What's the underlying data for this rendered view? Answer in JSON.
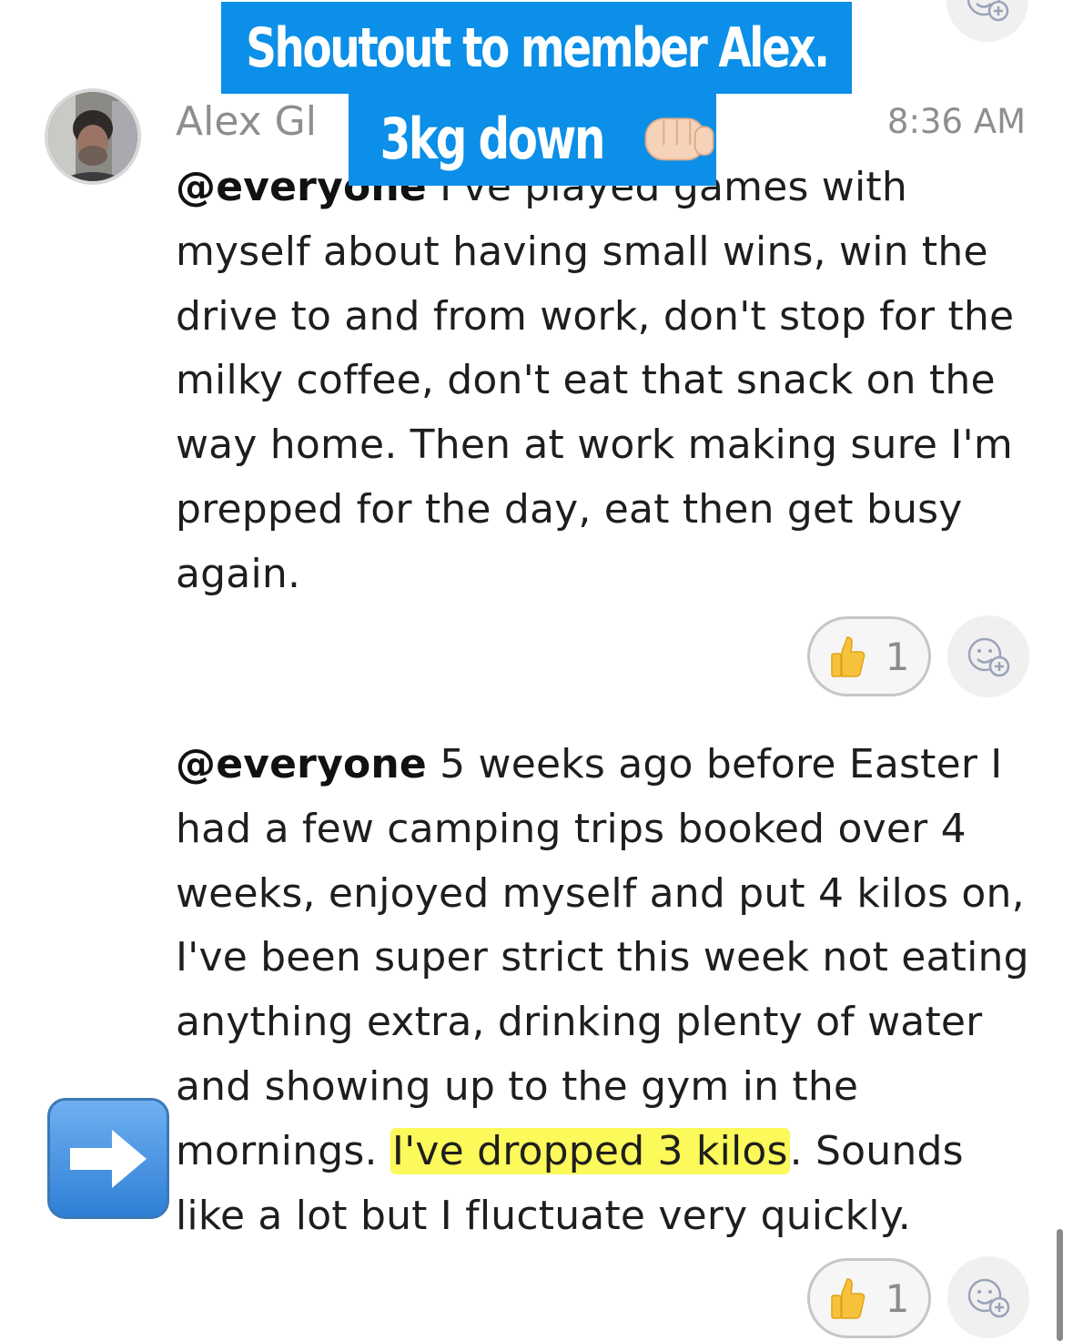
{
  "banner": {
    "line1": "Shoutout to member Alex.",
    "line2": "3kg down"
  },
  "post": {
    "author": "Alex Gl",
    "timestamp": "8:36 AM",
    "message1": {
      "mention": "@everyone",
      "text": " I've played games with myself about having small wins, win the drive to and from work, don't stop for the milky coffee, don't eat that snack on the way home. Then at work making sure I'm prepped for the day, eat then get busy again."
    },
    "message1_reaction": {
      "emoji": "thumbs-up",
      "count": "1"
    },
    "message2": {
      "mention": "@everyone",
      "text_before": " 5 weeks ago before Easter I had a few camping trips booked over 4 weeks, enjoyed myself and put 4 kilos on, I've been super strict this week not eating anything extra, drinking plenty of water and showing up to the gym in the mornings. ",
      "highlight": "I've dropped 3 kilos",
      "text_after": ". Sounds like a lot but I fluctuate very quickly."
    },
    "message2_reaction": {
      "emoji": "thumbs-up",
      "count": "1"
    }
  },
  "icons": {
    "add_reaction": "add-reaction-icon",
    "arrow": "right-arrow-icon",
    "fist": "fist-bump-icon"
  },
  "colors": {
    "banner_blue": "#0b8fe8",
    "highlight_yellow": "#fcf95a",
    "muted_text": "#8e8e8e"
  }
}
